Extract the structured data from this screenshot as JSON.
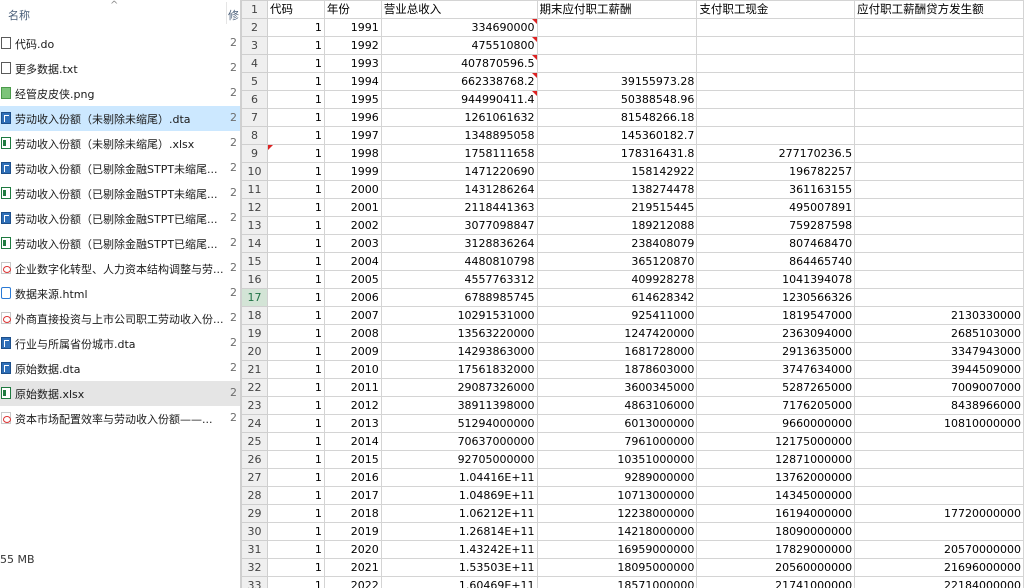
{
  "explorer": {
    "column_name": "名称",
    "column_modified": "修",
    "files": [
      {
        "name": "代码.do",
        "date": "2",
        "icon": "file-icon",
        "state": ""
      },
      {
        "name": "更多数据.txt",
        "date": "2",
        "icon": "file-icon",
        "state": ""
      },
      {
        "name": "经管皮皮侠.png",
        "date": "2",
        "icon": "image-icon",
        "state": ""
      },
      {
        "name": "劳动收入份额（未剔除未缩尾）.dta",
        "date": "2",
        "icon": "stata-data-icon",
        "state": "sel"
      },
      {
        "name": "劳动收入份额（未剔除未缩尾）.xlsx",
        "date": "2",
        "icon": "excel-icon",
        "state": ""
      },
      {
        "name": "劳动收入份额（已剔除金融STPT未缩尾...",
        "date": "2",
        "icon": "stata-data-icon",
        "state": ""
      },
      {
        "name": "劳动收入份额（已剔除金融STPT未缩尾...",
        "date": "2",
        "icon": "excel-icon",
        "state": ""
      },
      {
        "name": "劳动收入份额（已剔除金融STPT已缩尾...",
        "date": "2",
        "icon": "stata-data-icon",
        "state": ""
      },
      {
        "name": "劳动收入份额（已剔除金融STPT已缩尾...",
        "date": "2",
        "icon": "excel-icon",
        "state": ""
      },
      {
        "name": "企业数字化转型、人力资本结构调整与劳...",
        "date": "2",
        "icon": "pdf-icon",
        "state": ""
      },
      {
        "name": "数据来源.html",
        "date": "2",
        "icon": "html-icon",
        "state": ""
      },
      {
        "name": "外商直接投资与上市公司职工劳动收入份...",
        "date": "2",
        "icon": "pdf-icon",
        "state": ""
      },
      {
        "name": "行业与所属省份城市.dta",
        "date": "2",
        "icon": "stata-data-icon",
        "state": ""
      },
      {
        "name": "原始数据.dta",
        "date": "2",
        "icon": "stata-data-icon",
        "state": ""
      },
      {
        "name": "原始数据.xlsx",
        "date": "2",
        "icon": "excel-icon",
        "state": "hl"
      },
      {
        "name": "资本市场配置效率与劳动收入份额——...",
        "date": "2",
        "icon": "pdf-icon",
        "state": ""
      }
    ],
    "status": "55 MB"
  },
  "sheet": {
    "headers": [
      "代码",
      "年份",
      "营业总收入",
      "期末应付职工薪酬",
      "支付职工现金",
      "应付职工薪酬贷方发生额"
    ],
    "active_row": 17,
    "rows": [
      [
        "1",
        "1991",
        "334690000",
        "",
        "",
        ""
      ],
      [
        "1",
        "1992",
        "475510800",
        "",
        "",
        ""
      ],
      [
        "1",
        "1993",
        "407870596.5",
        "",
        "",
        ""
      ],
      [
        "1",
        "1994",
        "662338768.2",
        "39155973.28",
        "",
        ""
      ],
      [
        "1",
        "1995",
        "944990411.4",
        "50388548.96",
        "",
        ""
      ],
      [
        "1",
        "1996",
        "1261061632",
        "81548266.18",
        "",
        ""
      ],
      [
        "1",
        "1997",
        "1348895058",
        "145360182.7",
        "",
        ""
      ],
      [
        "1",
        "1998",
        "1758111658",
        "178316431.8",
        "277170236.5",
        ""
      ],
      [
        "1",
        "1999",
        "1471220690",
        "158142922",
        "196782257",
        ""
      ],
      [
        "1",
        "2000",
        "1431286264",
        "138274478",
        "361163155",
        ""
      ],
      [
        "1",
        "2001",
        "2118441363",
        "219515445",
        "495007891",
        ""
      ],
      [
        "1",
        "2002",
        "3077098847",
        "189212088",
        "759287598",
        ""
      ],
      [
        "1",
        "2003",
        "3128836264",
        "238408079",
        "807468470",
        ""
      ],
      [
        "1",
        "2004",
        "4480810798",
        "365120870",
        "864465740",
        ""
      ],
      [
        "1",
        "2005",
        "4557763312",
        "409928278",
        "1041394078",
        ""
      ],
      [
        "1",
        "2006",
        "6788985745",
        "614628342",
        "1230566326",
        ""
      ],
      [
        "1",
        "2007",
        "10291531000",
        "925411000",
        "1819547000",
        "2130330000"
      ],
      [
        "1",
        "2008",
        "13563220000",
        "1247420000",
        "2363094000",
        "2685103000"
      ],
      [
        "1",
        "2009",
        "14293863000",
        "1681728000",
        "2913635000",
        "3347943000"
      ],
      [
        "1",
        "2010",
        "17561832000",
        "1878603000",
        "3747634000",
        "3944509000"
      ],
      [
        "1",
        "2011",
        "29087326000",
        "3600345000",
        "5287265000",
        "7009007000"
      ],
      [
        "1",
        "2012",
        "38911398000",
        "4863106000",
        "7176205000",
        "8438966000"
      ],
      [
        "1",
        "2013",
        "51294000000",
        "6013000000",
        "9660000000",
        "10810000000"
      ],
      [
        "1",
        "2014",
        "70637000000",
        "7961000000",
        "12175000000",
        ""
      ],
      [
        "1",
        "2015",
        "92705000000",
        "10351000000",
        "12871000000",
        ""
      ],
      [
        "1",
        "2016",
        "1.04416E+11",
        "9289000000",
        "13762000000",
        ""
      ],
      [
        "1",
        "2017",
        "1.04869E+11",
        "10713000000",
        "14345000000",
        ""
      ],
      [
        "1",
        "2018",
        "1.06212E+11",
        "12238000000",
        "16194000000",
        "17720000000"
      ],
      [
        "1",
        "2019",
        "1.26814E+11",
        "14218000000",
        "18090000000",
        ""
      ],
      [
        "1",
        "2020",
        "1.43242E+11",
        "16959000000",
        "17829000000",
        "20570000000"
      ],
      [
        "1",
        "2021",
        "1.53503E+11",
        "18095000000",
        "20560000000",
        "21696000000"
      ],
      [
        "1",
        "2022",
        "1.60469E+11",
        "18571000000",
        "21741000000",
        "22184000000"
      ]
    ]
  }
}
